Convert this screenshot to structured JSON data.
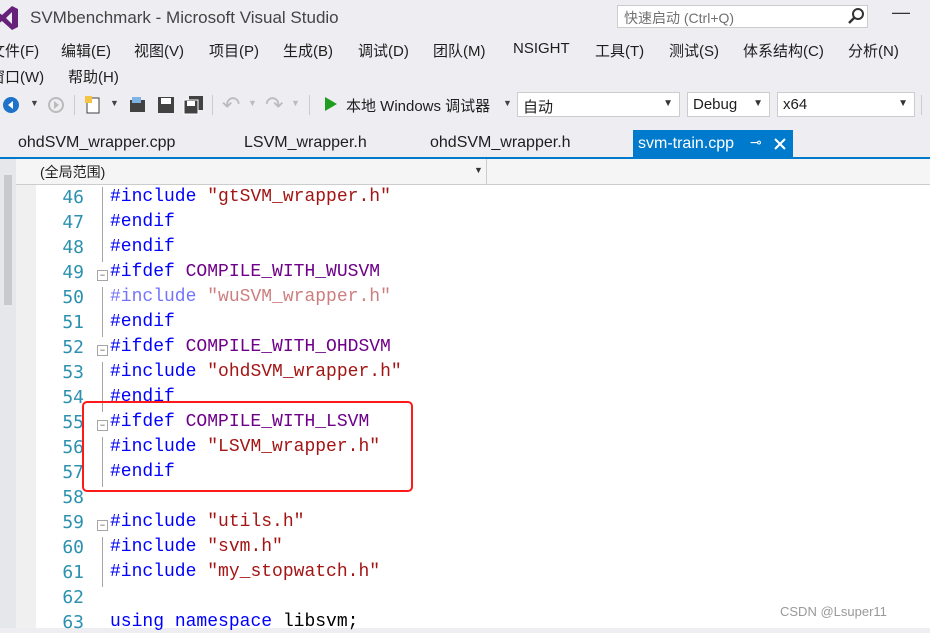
{
  "window": {
    "title": "SVMbenchmark - Microsoft Visual Studio",
    "quick_launch_placeholder": "快速启动 (Ctrl+Q)",
    "minimize_glyph": "—"
  },
  "menu": [
    "文件(F)",
    "编辑(E)",
    "视图(V)",
    "项目(P)",
    "生成(B)",
    "调试(D)",
    "团队(M)",
    "NSIGHT",
    "工具(T)",
    "测试(S)",
    "体系结构(C)",
    "分析(N)",
    "窗口(W)",
    "帮助(H)"
  ],
  "toolbar": {
    "run_label": "本地 Windows 调试器",
    "solution_config": "自动",
    "build_config": "Debug",
    "platform": "x64"
  },
  "tabs": [
    "ohdSVM_wrapper.cpp",
    "LSVM_wrapper.h",
    "ohdSVM_wrapper.h",
    "svm-train.cpp"
  ],
  "active_tab_index": 3,
  "scope": "(全局范围)",
  "code_lines": [
    {
      "n": "46",
      "text": "#include \"gtSVM_wrapper.h\""
    },
    {
      "n": "47",
      "text": "#endif"
    },
    {
      "n": "48",
      "text": "#endif"
    },
    {
      "n": "49",
      "text": "#ifdef COMPILE_WITH_WUSVM"
    },
    {
      "n": "50",
      "text": "#include \"wuSVM_wrapper.h\""
    },
    {
      "n": "51",
      "text": "#endif"
    },
    {
      "n": "52",
      "text": "#ifdef COMPILE_WITH_OHDSVM"
    },
    {
      "n": "53",
      "text": "#include \"ohdSVM_wrapper.h\""
    },
    {
      "n": "54",
      "text": "#endif"
    },
    {
      "n": "55",
      "text": "#ifdef COMPILE_WITH_LSVM"
    },
    {
      "n": "56",
      "text": "#include \"LSVM_wrapper.h\""
    },
    {
      "n": "57",
      "text": "#endif"
    },
    {
      "n": "58",
      "text": ""
    },
    {
      "n": "59",
      "text": "#include \"utils.h\""
    },
    {
      "n": "60",
      "text": "#include \"svm.h\""
    },
    {
      "n": "61",
      "text": "#include \"my_stopwatch.h\""
    },
    {
      "n": "62",
      "text": ""
    },
    {
      "n": "63",
      "text": "using namespace libsvm;"
    }
  ],
  "watermark": "CSDN @Lsuper11",
  "colors": {
    "accent": "#007acc",
    "keyword": "#0000ff",
    "string": "#a31515",
    "macro": "#6f008a",
    "line_number": "#2b91af",
    "highlight_box": "#ff1a1a"
  }
}
